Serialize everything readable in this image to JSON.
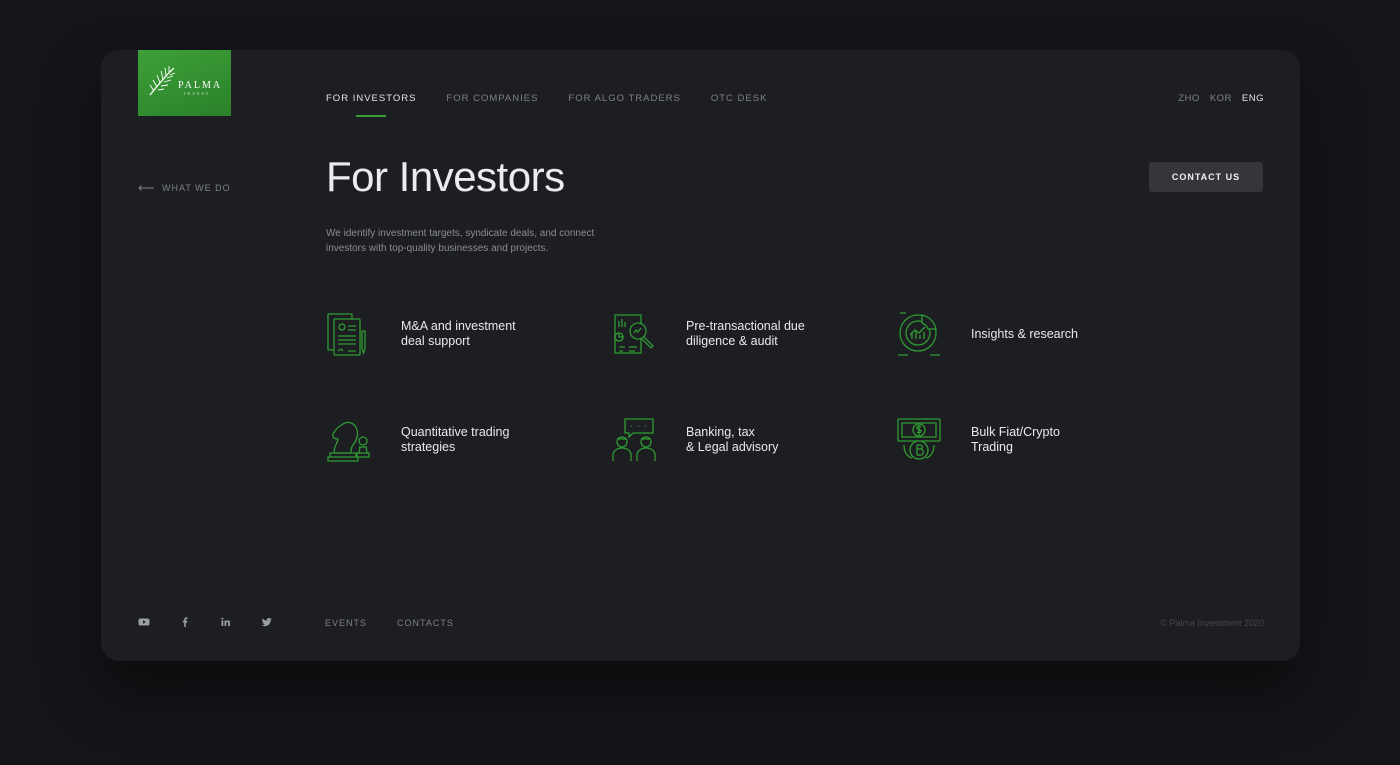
{
  "brand": {
    "name": "PALMA",
    "tagline": "INVEST",
    "accent": "#36a037"
  },
  "nav": [
    {
      "label": "FOR INVESTORS",
      "active": true
    },
    {
      "label": "FOR COMPANIES",
      "active": false
    },
    {
      "label": "FOR ALGO TRADERS",
      "active": false
    },
    {
      "label": "OTC DESK",
      "active": false
    }
  ],
  "languages": [
    "ZHO",
    "KOR",
    "ENG"
  ],
  "active_language": "ENG",
  "back_link": "WHAT WE DO",
  "page_title": "For Investors",
  "contact_button": "CONTACT US",
  "description": "We identify investment targets, syndicate deals, and connect investors with top-quality businesses and projects.",
  "services": [
    {
      "label": "M&A and investment\ndeal support",
      "icon": "document-contract-icon"
    },
    {
      "label": "Pre-transactional due\ndiligence & audit",
      "icon": "report-magnifier-icon"
    },
    {
      "label": "Insights & research",
      "icon": "chart-analytics-icon"
    },
    {
      "label": "Quantitative trading\nstrategies",
      "icon": "chess-strategy-icon"
    },
    {
      "label": "Banking, tax\n& Legal advisory",
      "icon": "consultants-chat-icon"
    },
    {
      "label": "Bulk Fiat/Crypto\nTrading",
      "icon": "dollar-bitcoin-exchange-icon"
    }
  ],
  "social": [
    "youtube-icon",
    "facebook-icon",
    "linkedin-icon",
    "twitter-icon"
  ],
  "footer_nav": [
    "EVENTS",
    "CONTACTS"
  ],
  "copyright": "© Palma Investment 2020"
}
